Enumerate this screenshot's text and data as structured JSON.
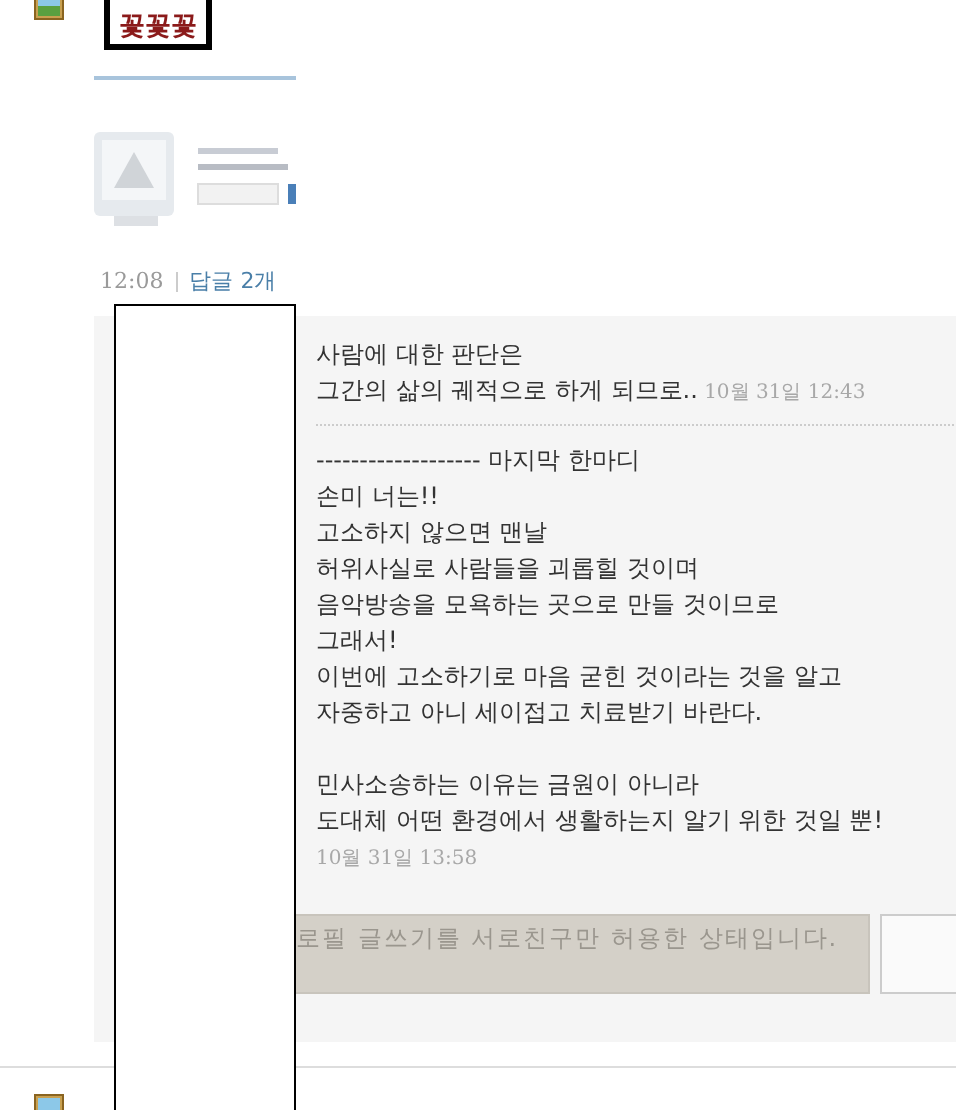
{
  "post": {
    "author_tag": "꽃꽃꽃",
    "time": "12:08",
    "reply_count": "답글 2개"
  },
  "comments": [
    {
      "kind": "inline-time",
      "paragraphs": [
        [
          "사람에 대한 판단은",
          "그간의 삶의 궤적으로 하게 되므로.."
        ]
      ],
      "time": "10월 31일 12:43"
    },
    {
      "kind": "block-time",
      "paragraphs": [
        [
          "------------------- 마지막 한마디",
          "손미 너는!!",
          "고소하지 않으면 맨날",
          "허위사실로 사람들을 괴롭힐 것이며",
          "음악방송을 모욕하는 곳으로 만들 것이므로",
          "그래서!",
          "이번에 고소하기로 마음 굳힌 것이라는 것을 알고",
          "자중하고 아니 세이접고 치료받기 바란다."
        ],
        [
          "민사소송하는 이유는 금원이 아니라",
          "도대체 어떤 환경에서 생활하는지 알기 위한 것일 뿐!"
        ]
      ],
      "time": "10월 31일 13:58"
    }
  ],
  "reply_box": {
    "text": "로필 글쓰기를 서로친구만 허용한 상태입니다.",
    "disabled": true
  }
}
